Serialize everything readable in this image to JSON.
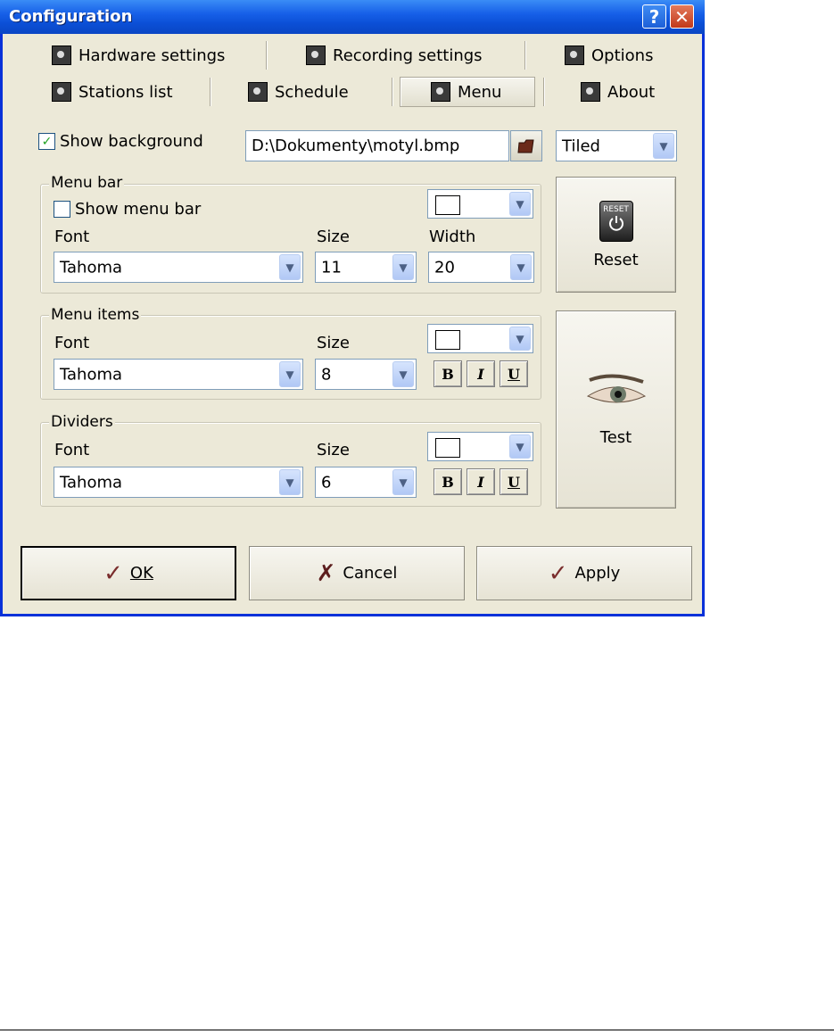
{
  "window": {
    "title": "Configuration",
    "help_glyph": "?",
    "close_glyph": "✕"
  },
  "tabs": {
    "row1": [
      {
        "label": "Hardware settings",
        "icon": "plug-icon"
      },
      {
        "label": "Recording settings",
        "icon": "record-icon"
      },
      {
        "label": "Options",
        "icon": "monitor-icon"
      }
    ],
    "row2": [
      {
        "label": "Stations list",
        "icon": "signal-icon"
      },
      {
        "label": "Schedule",
        "icon": "clock-icon"
      },
      {
        "label": "Menu",
        "icon": "menu-icon",
        "active": true
      },
      {
        "label": "About",
        "icon": "broadcast-icon"
      }
    ]
  },
  "background": {
    "checkbox_label": "Show background",
    "checked": true,
    "path": "D:\\Dokumenty\\motyl.bmp",
    "mode": "Tiled"
  },
  "menu_bar": {
    "legend": "Menu bar",
    "checkbox_label": "Show menu bar",
    "checked": false,
    "font_label": "Font",
    "font": "Tahoma",
    "size_label": "Size",
    "size": "11",
    "width_label": "Width",
    "width": "20",
    "color": "#ffffff"
  },
  "menu_items": {
    "legend": "Menu items",
    "font_label": "Font",
    "font": "Tahoma",
    "size_label": "Size",
    "size": "8",
    "color": "#ffffff",
    "bold": "B",
    "italic": "I",
    "underline": "U"
  },
  "dividers": {
    "legend": "Dividers",
    "font_label": "Font",
    "font": "Tahoma",
    "size_label": "Size",
    "size": "6",
    "color": "#ffffff",
    "bold": "B",
    "italic": "I",
    "underline": "U"
  },
  "side_buttons": {
    "reset": "Reset",
    "reset_icon_text": "RESET",
    "test": "Test"
  },
  "footer": {
    "ok": "OK",
    "cancel": "Cancel",
    "apply": "Apply"
  },
  "dropdown_glyph": "▼",
  "checkmark_glyph": "✓"
}
